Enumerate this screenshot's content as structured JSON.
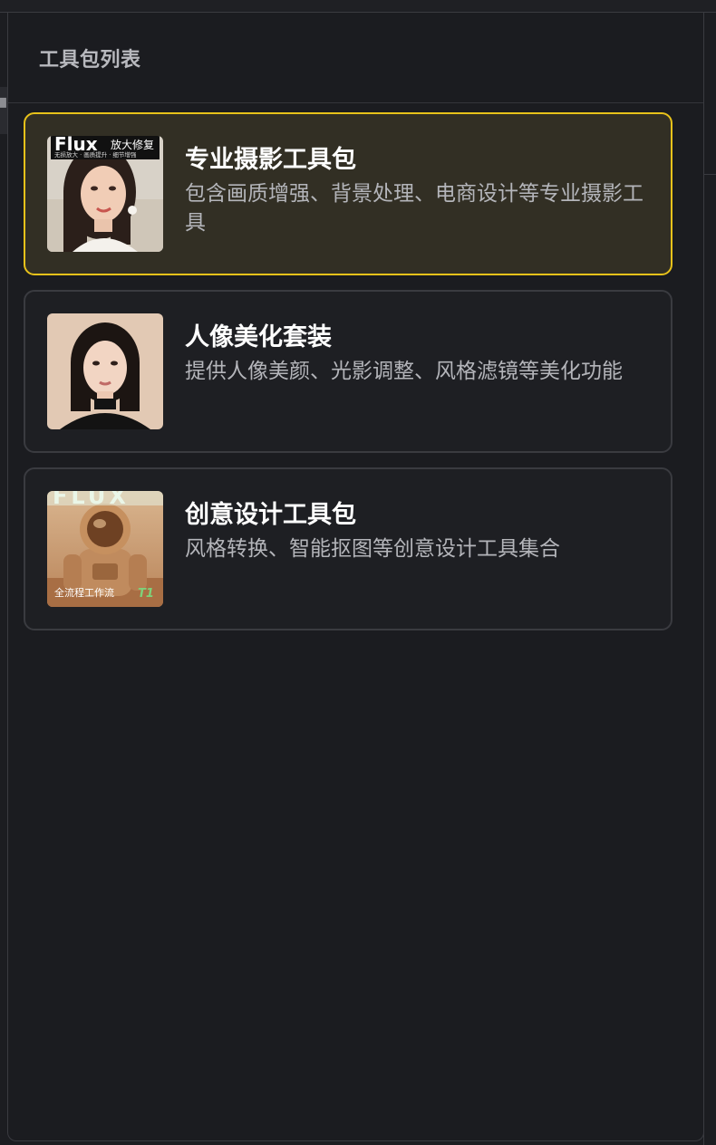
{
  "panel": {
    "title": "工具包列表"
  },
  "toolkits": [
    {
      "title": "专业摄影工具包",
      "description": "包含画质增强、背景处理、电商设计等专业摄影工具",
      "selected": true,
      "thumb": {
        "icon": "portrait-woman-image",
        "brand": "Flux",
        "tag": "放大修复",
        "subtext": "无损放大 · 画质提升 · 细节增强"
      }
    },
    {
      "title": "人像美化套装",
      "description": "提供人像美颜、光影调整、风格滤镜等美化功能",
      "selected": false,
      "thumb": {
        "icon": "portrait-woman-image"
      }
    },
    {
      "title": "创意设计工具包",
      "description": "风格转换、智能抠图等创意设计工具集合",
      "selected": false,
      "thumb": {
        "icon": "astronaut-image",
        "brand": "FLUX",
        "tag": "全流程工作流",
        "tag_suffix": "T1"
      }
    }
  ],
  "colors": {
    "selected_border": "#e8c21a",
    "selected_bg": "#322f24",
    "card_border": "#3a3b40",
    "panel_bg": "#1b1c20"
  }
}
